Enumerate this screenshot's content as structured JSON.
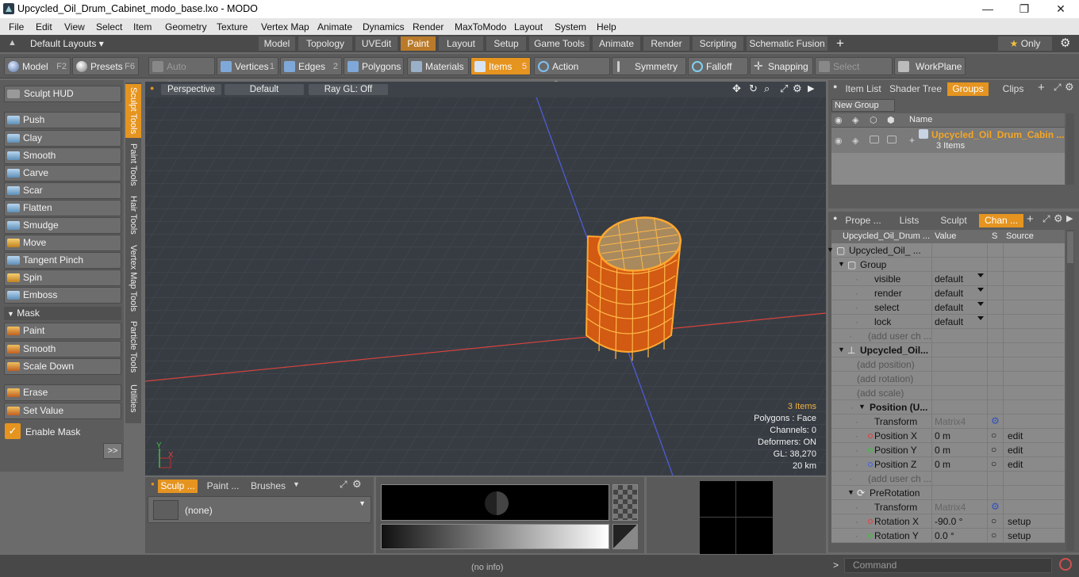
{
  "window": {
    "title": "Upcycled_Oil_Drum_Cabinet_modo_base.lxo - MODO",
    "min": "—",
    "max": "❐",
    "close": "✕"
  },
  "menu": [
    "File",
    "Edit",
    "View",
    "Select",
    "Item",
    "Geometry",
    "Texture",
    "Vertex Map",
    "Animate",
    "Dynamics",
    "Render",
    "MaxToModo",
    "Layout",
    "System",
    "Help"
  ],
  "layouts": {
    "selector": "Default Layouts ▾",
    "tabs": [
      "Model",
      "Topology",
      "UVEdit",
      "Paint",
      "Layout",
      "Setup",
      "Game Tools",
      "Animate",
      "Render",
      "Scripting",
      "Schematic Fusion"
    ],
    "active": "Paint",
    "add": "+",
    "only": "Only"
  },
  "toolbar": {
    "model": "Model",
    "model_key": "F2",
    "presets": "Presets",
    "presets_key": "F6",
    "auto_select": "Auto Select",
    "vertices": "Vertices",
    "vertices_key": "1",
    "edges": "Edges",
    "edges_key": "2",
    "polygons": "Polygons",
    "materials": "Materials",
    "items": "Items",
    "items_key": "5",
    "action_center": "Action Center",
    "symmetry": "Symmetry",
    "falloff": "Falloff",
    "snapping": "Snapping",
    "select_through": "Select Through",
    "workplane": "WorkPlane"
  },
  "sculpt": {
    "hud": "Sculpt HUD",
    "tools": [
      "Push",
      "Clay",
      "Smooth",
      "Carve",
      "Scar",
      "Flatten",
      "Smudge",
      "Move",
      "Tangent Pinch",
      "Spin",
      "Emboss"
    ],
    "mask_header": "Mask",
    "mask_tools": [
      "Paint",
      "Smooth",
      "Scale Down"
    ],
    "erase": "Erase",
    "set_value": "Set Value",
    "enable_mask": "Enable Mask",
    "more": ">>"
  },
  "vtabs": [
    "Sculpt Tools",
    "Paint Tools",
    "Hair Tools",
    "Vertex Map Tools",
    "Particle Tools",
    "Utilities"
  ],
  "viewport": {
    "view": "Perspective",
    "shading": "Default",
    "raygl": "Ray GL: Off",
    "stats": {
      "items": "3 Items",
      "polygons": "Polygons : Face",
      "channels": "Channels: 0",
      "deformers": "Deformers: ON",
      "gl": "GL: 38,270",
      "distance": "20 km"
    }
  },
  "bottom": {
    "tabs": [
      "Sculp ...",
      "Paint ...",
      "Brushes"
    ],
    "brush": "(none)"
  },
  "status": {
    "info": "(no info)",
    "command": "Command"
  },
  "groups": {
    "tabs": [
      "Item List",
      "Shader Tree",
      "Groups",
      "Clips"
    ],
    "active": "Groups",
    "new_group": "New Group",
    "col_name": "Name",
    "group_name": "Upcycled_Oil_Drum_Cabin ...",
    "group_count": "3 Items"
  },
  "channels": {
    "tabs": [
      "Prope ...",
      "Lists",
      "Sculpt",
      "Chan ..."
    ],
    "active": "Chan ...",
    "col_item": "Upcycled_Oil_Drum ...",
    "col_value": "Value",
    "col_s": "S",
    "col_source": "Source",
    "rows": [
      {
        "label": "Upcycled_Oil_ ...",
        "indent": 22,
        "value": "",
        "source": "",
        "icon": "mesh"
      },
      {
        "label": "Group",
        "indent": 36,
        "value": "",
        "source": "",
        "icon": "group"
      },
      {
        "label": "visible",
        "indent": 54,
        "value": "default",
        "source": "",
        "dd": true
      },
      {
        "label": "render",
        "indent": 54,
        "value": "default",
        "source": "",
        "dd": true
      },
      {
        "label": "select",
        "indent": 54,
        "value": "default",
        "source": "",
        "dd": true
      },
      {
        "label": "lock",
        "indent": 54,
        "value": "default",
        "source": "",
        "dd": true
      },
      {
        "label": "(add user ch ...",
        "indent": 46,
        "value": "",
        "source": "",
        "grey": true
      },
      {
        "label": "Upcycled_Oil...",
        "indent": 36,
        "value": "",
        "source": "",
        "bold": true,
        "icon": "locator"
      },
      {
        "label": "(add position)",
        "indent": 32,
        "value": "",
        "source": "",
        "grey": true
      },
      {
        "label": "(add rotation)",
        "indent": 32,
        "value": "",
        "source": "",
        "grey": true
      },
      {
        "label": "(add scale)",
        "indent": 32,
        "value": "",
        "source": "",
        "grey": true
      },
      {
        "label": "Position (U...",
        "indent": 48,
        "value": "",
        "source": "",
        "bold": true
      },
      {
        "label": "Transform",
        "indent": 54,
        "value": "Matrix4",
        "source": "",
        "grey_value": true,
        "s": "gear"
      },
      {
        "label": "Position X",
        "indent": 54,
        "value": "0 m",
        "source": "edit",
        "dot": "#e04040",
        "s": "circle"
      },
      {
        "label": "Position Y",
        "indent": 54,
        "value": "0 m",
        "source": "edit",
        "dot": "#40c040",
        "s": "circle"
      },
      {
        "label": "Position Z",
        "indent": 54,
        "value": "0 m",
        "source": "edit",
        "dot": "#4060e0",
        "s": "circle"
      },
      {
        "label": "(add user ch ...",
        "indent": 46,
        "value": "",
        "source": "",
        "grey": true
      },
      {
        "label": "PreRotation",
        "indent": 48,
        "value": "",
        "source": "",
        "icon": "rot"
      },
      {
        "label": "Transform",
        "indent": 54,
        "value": "Matrix4",
        "source": "",
        "grey_value": true,
        "s": "gear"
      },
      {
        "label": "Rotation X",
        "indent": 54,
        "value": "-90.0 °",
        "source": "setup",
        "dot": "#e04040",
        "s": "circle"
      },
      {
        "label": "Rotation Y",
        "indent": 54,
        "value": "0.0 °",
        "source": "setup",
        "dot": "#40c040",
        "s": "circle"
      }
    ]
  }
}
